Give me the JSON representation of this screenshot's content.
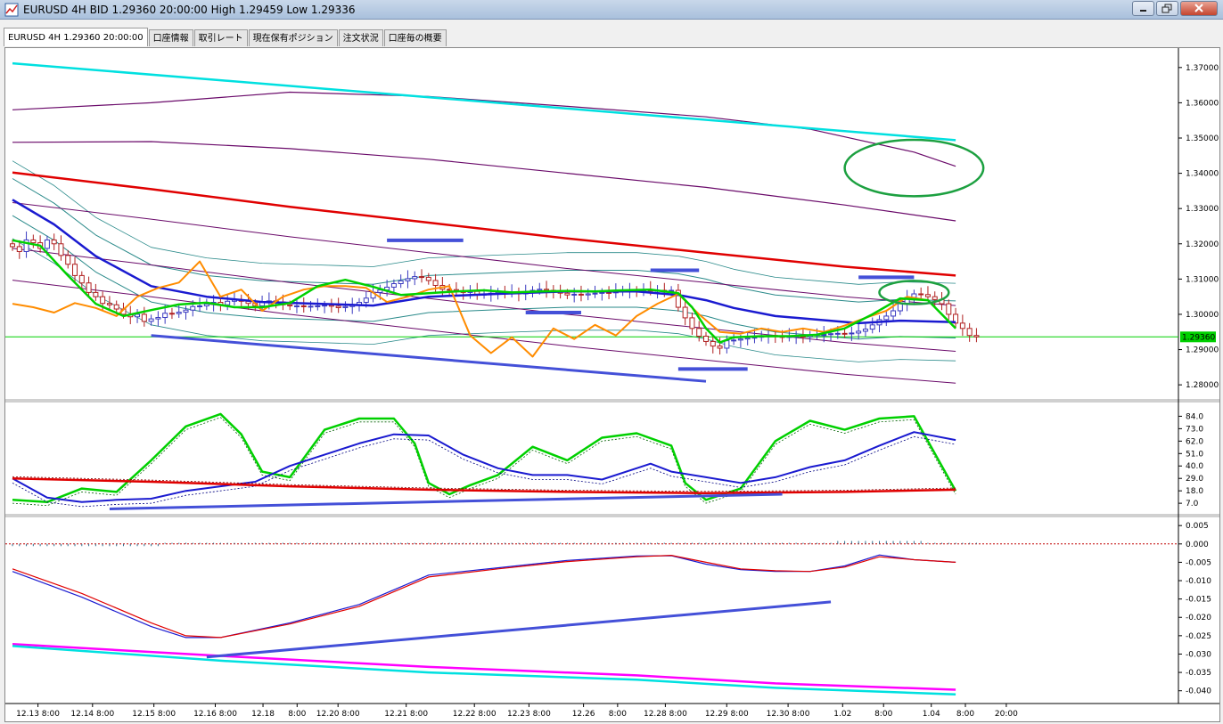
{
  "window": {
    "title": "EURUSD 4H BID 1.29360 20:00:00 High 1.29459 Low 1.29336",
    "icon": "chart-app-icon"
  },
  "tabs": [
    {
      "label": "EURUSD 4H 1.29360 20:00:00"
    },
    {
      "label": "口座情報"
    },
    {
      "label": "取引レート"
    },
    {
      "label": "現在保有ポジション"
    },
    {
      "label": "注文状況"
    },
    {
      "label": "口座毎の概要"
    }
  ],
  "colors": {
    "green": "#00d000",
    "orange": "#ff8c00",
    "blue": "#1a1ad0",
    "red": "#e00000",
    "cyan": "#00e0e0",
    "magenta": "#ff00ff",
    "purple": "#6a0a6a",
    "teal": "#2a8a8a",
    "annot_blue": "#4450d8",
    "ellipse": "#1ca040"
  },
  "price_axis": {
    "ticks": [
      "1.37000",
      "1.36000",
      "1.35000",
      "1.34000",
      "1.33000",
      "1.32000",
      "1.31000",
      "1.30000",
      "1.29000",
      "1.28000"
    ],
    "current": "1.29360"
  },
  "stoch_axis": {
    "ticks": [
      "84.0",
      "73.0",
      "62.0",
      "51.0",
      "40.0",
      "29.0",
      "18.0",
      "7.0"
    ]
  },
  "macd_axis": {
    "ticks": [
      "0.005",
      "0.000",
      "-0.005",
      "-0.010",
      "-0.015",
      "-0.020",
      "-0.025",
      "-0.030",
      "-0.035",
      "-0.040"
    ]
  },
  "time_axis": {
    "labels": [
      "12.13 8:00",
      "12.14 8:00",
      "12.15 8:00",
      "12.16 8:00",
      "12.18",
      "8:00",
      "12.20 8:00",
      "12.21 8:00",
      "12.22 8:00",
      "12.23 8:00",
      "12.26",
      "8:00",
      "12.28 8:00",
      "12.29 8:00",
      "12.30 8:00",
      "1.02",
      "8:00",
      "1.04",
      "8:00",
      "20:00"
    ]
  },
  "chart_data": [
    {
      "type": "candlestick",
      "panel": "price",
      "symbol": "EURUSD",
      "timeframe": "4H",
      "ylim": [
        1.2765,
        1.3745
      ],
      "closes": [
        1.3192,
        1.3178,
        1.3211,
        1.3203,
        1.3187,
        1.3211,
        1.32,
        1.3167,
        1.3142,
        1.311,
        1.3089,
        1.3062,
        1.305,
        1.3031,
        1.3027,
        1.3015,
        1.3,
        1.2993,
        1.3,
        1.298,
        1.2987,
        1.2991,
        1.3003,
        1.3002,
        1.3006,
        1.3012,
        1.3022,
        1.3024,
        1.3029,
        1.3034,
        1.3027,
        1.3037,
        1.3041,
        1.3037,
        1.3031,
        1.3024,
        1.3035,
        1.3038,
        1.3035,
        1.3027,
        1.3024,
        1.3024,
        1.3023,
        1.3023,
        1.3024,
        1.3026,
        1.3023,
        1.3019,
        1.3022,
        1.3026,
        1.3034,
        1.3046,
        1.3062,
        1.3069,
        1.3077,
        1.3087,
        1.3095,
        1.3101,
        1.3107,
        1.3105,
        1.3096,
        1.3082,
        1.3071,
        1.307,
        1.3067,
        1.3062,
        1.3065,
        1.3056,
        1.3057,
        1.306,
        1.3063,
        1.306,
        1.3061,
        1.3058,
        1.3063,
        1.3068,
        1.3071,
        1.3068,
        1.3063,
        1.306,
        1.3055,
        1.3057,
        1.3055,
        1.3058,
        1.306,
        1.3062,
        1.3061,
        1.3064,
        1.3066,
        1.3068,
        1.3067,
        1.307,
        1.3066,
        1.3068,
        1.3067,
        1.3068,
        1.302,
        1.299,
        1.296,
        1.2938,
        1.2923,
        1.291,
        1.2904,
        1.2925,
        1.2927,
        1.293,
        1.2933,
        1.2935,
        1.2938,
        1.294,
        1.2937,
        1.2935,
        1.2937,
        1.2938,
        1.2936,
        1.2941,
        1.2942,
        1.2943,
        1.2945,
        1.2946,
        1.2945,
        1.2947,
        1.2952,
        1.2958,
        1.297,
        1.2985,
        1.2995,
        1.301,
        1.303,
        1.3048,
        1.3058,
        1.3056,
        1.305,
        1.3042,
        1.303,
        1.3,
        1.2975,
        1.296,
        1.294,
        1.2936
      ],
      "last": 1.2936,
      "high": 1.29459,
      "low": 1.29336,
      "lines": {
        "cyan_ma": {
          "x": [
            0,
            136
          ],
          "y": [
            1.3712,
            1.3494
          ]
        },
        "purple_upper": {
          "x": [
            0,
            20,
            40,
            60,
            80,
            100,
            115,
            130,
            136
          ],
          "y": [
            1.358,
            1.36,
            1.363,
            1.3618,
            1.359,
            1.356,
            1.3525,
            1.346,
            1.342
          ]
        },
        "purple_mid": {
          "x": [
            0,
            20,
            40,
            60,
            80,
            100,
            120,
            136
          ],
          "y": [
            1.3488,
            1.349,
            1.347,
            1.344,
            1.34,
            1.336,
            1.331,
            1.3265
          ]
        },
        "red_ma": {
          "x": [
            0,
            20,
            40,
            60,
            80,
            100,
            120,
            136
          ],
          "y": [
            1.3402,
            1.3355,
            1.3305,
            1.326,
            1.3215,
            1.3175,
            1.3135,
            1.311
          ]
        },
        "blue_ma": {
          "x": [
            0,
            6,
            12,
            20,
            28,
            36,
            44,
            52,
            60,
            70,
            80,
            90,
            96,
            100,
            104,
            110,
            116,
            122,
            128,
            136
          ],
          "y": [
            1.3325,
            1.3255,
            1.3165,
            1.308,
            1.305,
            1.3035,
            1.303,
            1.3025,
            1.305,
            1.3058,
            1.3065,
            1.3065,
            1.3055,
            1.304,
            1.3018,
            1.2995,
            1.2985,
            1.2975,
            1.2982,
            1.2978
          ]
        },
        "orange_line": {
          "x": [
            0,
            3,
            6,
            9,
            12,
            15,
            18,
            21,
            24,
            27,
            30,
            33,
            36,
            39,
            42,
            45,
            48,
            51,
            54,
            57,
            60,
            63,
            66,
            69,
            72,
            75,
            78,
            81,
            84,
            87,
            90,
            93,
            96,
            99,
            102,
            105,
            108,
            111,
            114,
            117,
            120,
            123,
            126,
            129,
            132,
            136
          ],
          "y": [
            1.303,
            1.302,
            1.3005,
            1.3032,
            1.3018,
            1.2995,
            1.305,
            1.3075,
            1.309,
            1.315,
            1.305,
            1.307,
            1.301,
            1.305,
            1.307,
            1.308,
            1.308,
            1.3075,
            1.3035,
            1.305,
            1.307,
            1.308,
            1.294,
            1.289,
            1.2935,
            1.288,
            1.296,
            1.293,
            1.297,
            1.294,
            1.2995,
            1.303,
            1.3058,
            1.3,
            1.295,
            1.2945,
            1.296,
            1.295,
            1.296,
            1.295,
            1.2968,
            1.299,
            1.301,
            1.305,
            1.304,
            1.296
          ]
        },
        "green_smooth": {
          "x": [
            0,
            4,
            8,
            12,
            16,
            20,
            24,
            28,
            32,
            36,
            40,
            44,
            48,
            52,
            56,
            60,
            64,
            68,
            72,
            76,
            80,
            84,
            88,
            92,
            96,
            98,
            100,
            102,
            104,
            108,
            112,
            116,
            120,
            124,
            128,
            132,
            136
          ],
          "y": [
            1.321,
            1.3195,
            1.311,
            1.303,
            1.2995,
            1.3012,
            1.3028,
            1.3033,
            1.302,
            1.302,
            1.3032,
            1.308,
            1.3098,
            1.3078,
            1.3055,
            1.306,
            1.3065,
            1.3068,
            1.3062,
            1.3065,
            1.3066,
            1.3065,
            1.3068,
            1.307,
            1.306,
            1.302,
            1.296,
            1.292,
            1.2935,
            1.2938,
            1.2938,
            1.2942,
            1.296,
            1.3,
            1.3045,
            1.304,
            1.296
          ]
        }
      },
      "annotations": {
        "ellipses": [
          {
            "cx": 130,
            "cy": 1.3415,
            "rx": 10,
            "ry": 0.008
          },
          {
            "cx": 130,
            "cy": 1.3062,
            "rx": 5,
            "ry": 0.0033
          }
        ],
        "segments": [
          {
            "x": [
              54,
              65
            ],
            "y": [
              1.321,
              1.321
            ]
          },
          {
            "x": [
              92,
              99
            ],
            "y": [
              1.3125,
              1.3125
            ]
          },
          {
            "x": [
              74,
              82
            ],
            "y": [
              1.3005,
              1.3005
            ]
          },
          {
            "x": [
              122,
              130
            ],
            "y": [
              1.3105,
              1.3105
            ]
          },
          {
            "x": [
              96,
              106
            ],
            "y": [
              1.2845,
              1.2845
            ]
          },
          {
            "x": [
              20,
              100
            ],
            "y": [
              1.294,
              1.281
            ]
          }
        ]
      }
    },
    {
      "type": "line",
      "panel": "stochastic",
      "ylim": [
        0,
        93
      ],
      "series": [
        {
          "color": "green",
          "x": [
            0,
            5,
            10,
            15,
            20,
            25,
            30,
            33,
            36,
            40,
            45,
            50,
            55,
            58,
            60,
            63,
            66,
            70,
            75,
            80,
            85,
            90,
            95,
            97,
            100,
            105,
            110,
            115,
            120,
            125,
            130,
            136
          ],
          "y": [
            10,
            8,
            20,
            17,
            45,
            75,
            86,
            68,
            35,
            30,
            72,
            82,
            82,
            60,
            25,
            15,
            23,
            32,
            57,
            45,
            65,
            69,
            58,
            25,
            10,
            20,
            62,
            80,
            72,
            82,
            84,
            18
          ]
        },
        {
          "color": "blue",
          "x": [
            0,
            5,
            10,
            15,
            20,
            25,
            30,
            35,
            40,
            45,
            50,
            55,
            60,
            65,
            70,
            75,
            80,
            85,
            90,
            92,
            95,
            100,
            105,
            110,
            115,
            120,
            125,
            130,
            136
          ],
          "y": [
            29,
            12,
            8,
            10,
            11,
            18,
            22,
            26,
            40,
            50,
            60,
            68,
            67,
            50,
            38,
            32,
            32,
            28,
            38,
            42,
            35,
            30,
            25,
            30,
            39,
            45,
            58,
            70,
            63
          ]
        },
        {
          "color": "red",
          "x": [
            0,
            20,
            40,
            60,
            80,
            100,
            120,
            136
          ],
          "y": [
            29,
            26,
            22,
            19,
            17,
            16,
            17,
            19
          ]
        }
      ],
      "annotations": {
        "segments": [
          {
            "x": [
              14,
              111
            ],
            "y": [
              2,
              15
            ]
          }
        ]
      }
    },
    {
      "type": "line",
      "panel": "macd",
      "ylim": [
        -0.0425,
        0.0065
      ],
      "series": [
        {
          "color": "blue",
          "x": [
            0,
            10,
            20,
            25,
            30,
            40,
            50,
            60,
            70,
            80,
            90,
            95,
            100,
            105,
            110,
            115,
            120,
            125,
            130,
            136
          ],
          "y": [
            -0.0075,
            -0.0145,
            -0.0225,
            -0.0255,
            -0.0255,
            -0.0215,
            -0.0165,
            -0.0085,
            -0.0065,
            -0.0045,
            -0.0033,
            -0.0032,
            -0.0055,
            -0.007,
            -0.0075,
            -0.0075,
            -0.006,
            -0.003,
            -0.0043,
            -0.005
          ]
        },
        {
          "color": "red",
          "x": [
            0,
            10,
            20,
            25,
            30,
            40,
            50,
            60,
            70,
            80,
            90,
            95,
            100,
            105,
            110,
            115,
            120,
            125,
            130,
            136
          ],
          "y": [
            -0.0068,
            -0.0135,
            -0.0215,
            -0.025,
            -0.0255,
            -0.0218,
            -0.017,
            -0.009,
            -0.0068,
            -0.0048,
            -0.0035,
            -0.0031,
            -0.005,
            -0.0068,
            -0.0073,
            -0.0075,
            -0.0063,
            -0.0035,
            -0.0043,
            -0.005
          ]
        },
        {
          "color": "magenta",
          "x": [
            0,
            30,
            60,
            90,
            110,
            136
          ],
          "y": [
            -0.0273,
            -0.0305,
            -0.0335,
            -0.0358,
            -0.038,
            -0.0397
          ]
        },
        {
          "color": "cyan",
          "x": [
            0,
            30,
            60,
            90,
            110,
            136
          ],
          "y": [
            -0.0278,
            -0.0318,
            -0.035,
            -0.037,
            -0.0392,
            -0.041
          ]
        }
      ],
      "zero_line": 0.0,
      "annotations": {
        "segments": [
          {
            "x": [
              28,
              118
            ],
            "y": [
              -0.0308,
              -0.0158
            ]
          }
        ]
      }
    }
  ]
}
